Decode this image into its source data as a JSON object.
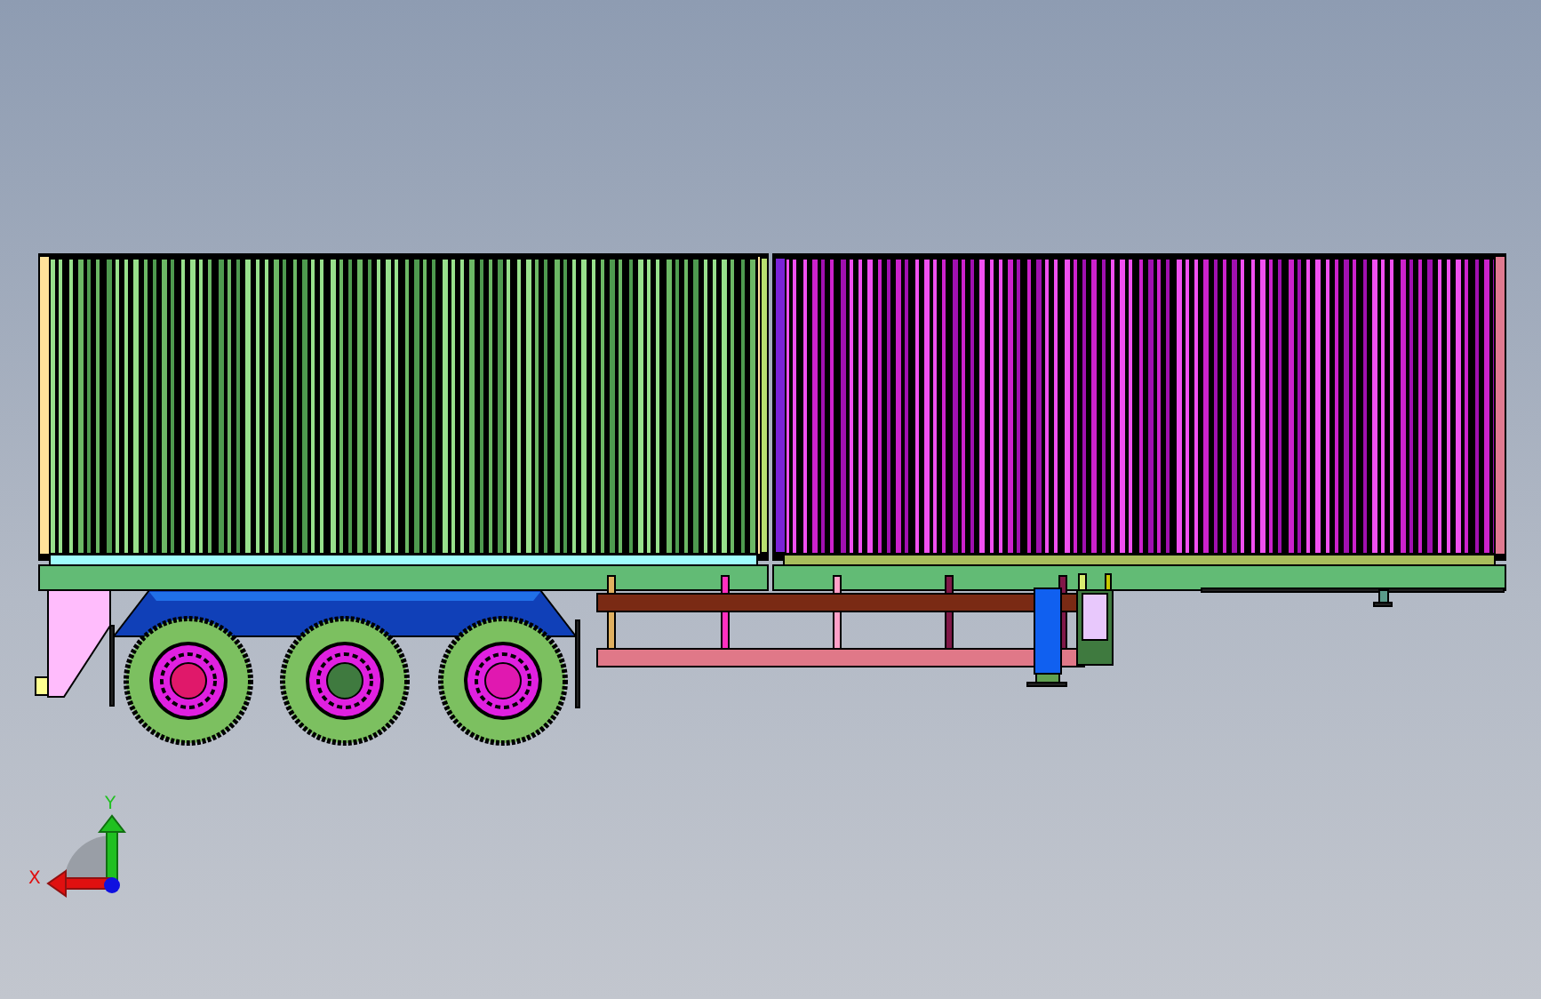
{
  "viewport": {
    "triad": {
      "x_label": "X",
      "y_label": "Y"
    }
  }
}
